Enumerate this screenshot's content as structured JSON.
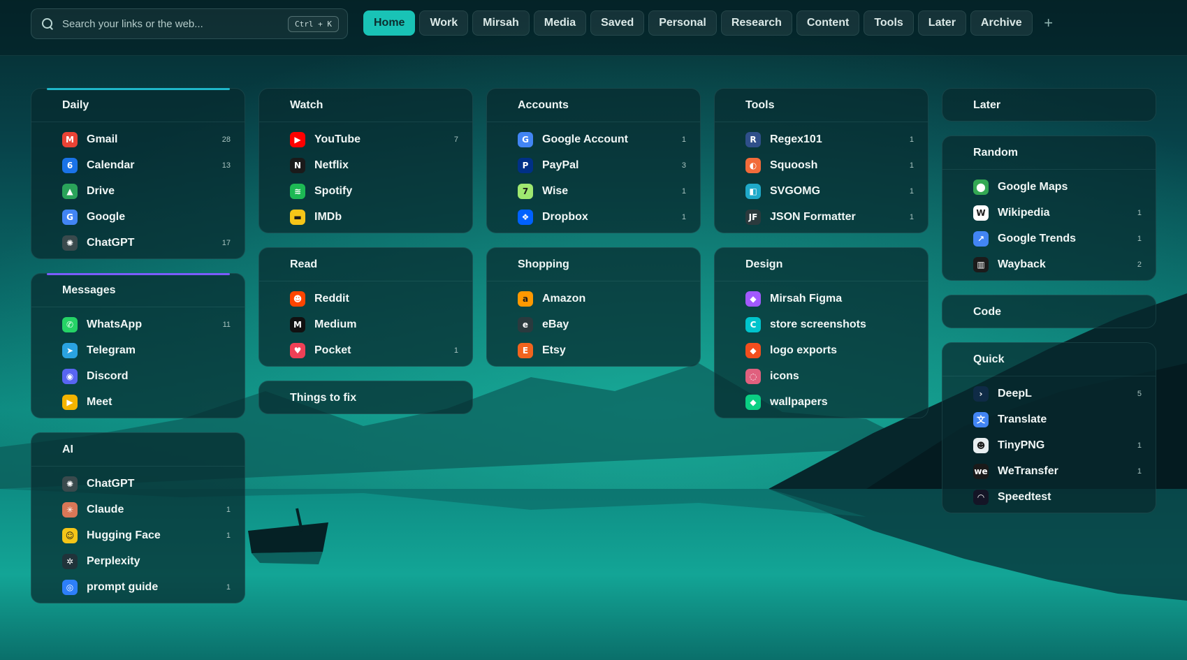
{
  "search": {
    "placeholder": "Search your links or the web...",
    "shortcut": "Ctrl + K"
  },
  "tabs": [
    "Home",
    "Work",
    "Mirsah",
    "Media",
    "Saved",
    "Personal",
    "Research",
    "Content",
    "Tools",
    "Later",
    "Archive"
  ],
  "active_tab": "Home",
  "add_tab_label": "+",
  "columns": [
    [
      {
        "title": "Daily",
        "accent": "#1fb6c9",
        "items": [
          {
            "label": "Gmail",
            "icon": "gmail-icon",
            "glyph": "M",
            "color": "#ea4335",
            "count": "28"
          },
          {
            "label": "Calendar",
            "icon": "calendar-icon",
            "glyph": "6",
            "color": "#1a73e8",
            "count": "13"
          },
          {
            "label": "Drive",
            "icon": "drive-icon",
            "glyph": "▲",
            "color": "#2aa35a",
            "count": ""
          },
          {
            "label": "Google",
            "icon": "google-icon",
            "glyph": "G",
            "color": "#4285f4",
            "count": ""
          },
          {
            "label": "ChatGPT",
            "icon": "chatgpt-icon",
            "glyph": "✺",
            "color": "#3a4a4d",
            "count": "17"
          }
        ]
      },
      {
        "title": "Messages",
        "accent": "#7b5cff",
        "items": [
          {
            "label": "WhatsApp",
            "icon": "whatsapp-icon",
            "glyph": "✆",
            "color": "#25d366",
            "count": "11"
          },
          {
            "label": "Telegram",
            "icon": "telegram-icon",
            "glyph": "➤",
            "color": "#2aa3e0",
            "count": ""
          },
          {
            "label": "Discord",
            "icon": "discord-icon",
            "glyph": "◉",
            "color": "#5865f2",
            "count": ""
          },
          {
            "label": "Meet",
            "icon": "meet-icon",
            "glyph": "▶",
            "color": "#f4b400",
            "count": ""
          }
        ]
      },
      {
        "title": "AI",
        "accent": "",
        "items": [
          {
            "label": "ChatGPT",
            "icon": "chatgpt-icon",
            "glyph": "✺",
            "color": "#3a4a4d",
            "count": ""
          },
          {
            "label": "Claude",
            "icon": "claude-icon",
            "glyph": "✳",
            "color": "#d97757",
            "count": "1"
          },
          {
            "label": "Hugging Face",
            "icon": "hugging-face-icon",
            "glyph": "☺",
            "color": "#f5c518",
            "count": "1"
          },
          {
            "label": "Perplexity",
            "icon": "perplexity-icon",
            "glyph": "✲",
            "color": "#20333a",
            "count": ""
          },
          {
            "label": "prompt guide",
            "icon": "prompt-guide-icon",
            "glyph": "◎",
            "color": "#2d7ff9",
            "count": "1"
          }
        ]
      }
    ],
    [
      {
        "title": "Watch",
        "accent": "",
        "items": [
          {
            "label": "YouTube",
            "icon": "youtube-icon",
            "glyph": "▶",
            "color": "#ff0000",
            "count": "7"
          },
          {
            "label": "Netflix",
            "icon": "netflix-icon",
            "glyph": "N",
            "color": "#1a1a1a",
            "count": ""
          },
          {
            "label": "Spotify",
            "icon": "spotify-icon",
            "glyph": "≋",
            "color": "#1db954",
            "count": ""
          },
          {
            "label": "IMDb",
            "icon": "imdb-icon",
            "glyph": "▬",
            "color": "#f5c518",
            "count": ""
          }
        ]
      },
      {
        "title": "Read",
        "accent": "",
        "items": [
          {
            "label": "Reddit",
            "icon": "reddit-icon",
            "glyph": "☻",
            "color": "#ff4500",
            "count": ""
          },
          {
            "label": "Medium",
            "icon": "medium-icon",
            "glyph": "M",
            "color": "#111111",
            "count": ""
          },
          {
            "label": "Pocket",
            "icon": "pocket-icon",
            "glyph": "♥",
            "color": "#ef4056",
            "count": "1"
          }
        ]
      },
      {
        "title": "Things to fix",
        "accent": "",
        "items": []
      }
    ],
    [
      {
        "title": "Accounts",
        "accent": "",
        "items": [
          {
            "label": "Google Account",
            "icon": "google-icon",
            "glyph": "G",
            "color": "#4285f4",
            "count": "1"
          },
          {
            "label": "PayPal",
            "icon": "paypal-icon",
            "glyph": "P",
            "color": "#003087",
            "count": "3"
          },
          {
            "label": "Wise",
            "icon": "wise-icon",
            "glyph": "7",
            "color": "#9fe870",
            "count": "1"
          },
          {
            "label": "Dropbox",
            "icon": "dropbox-icon",
            "glyph": "❖",
            "color": "#0061ff",
            "count": "1"
          }
        ]
      },
      {
        "title": "Shopping",
        "accent": "",
        "items": [
          {
            "label": "Amazon",
            "icon": "amazon-icon",
            "glyph": "a",
            "color": "#ff9900",
            "count": ""
          },
          {
            "label": "eBay",
            "icon": "ebay-icon",
            "glyph": "e",
            "color": "#2a3a3e",
            "count": ""
          },
          {
            "label": "Etsy",
            "icon": "etsy-icon",
            "glyph": "E",
            "color": "#f1641e",
            "count": ""
          }
        ]
      }
    ],
    [
      {
        "title": "Tools",
        "accent": "",
        "items": [
          {
            "label": "Regex101",
            "icon": "regex101-icon",
            "glyph": "R",
            "color": "#2f4f8a",
            "count": "1"
          },
          {
            "label": "Squoosh",
            "icon": "squoosh-icon",
            "glyph": "◐",
            "color": "#f26b3a",
            "count": "1"
          },
          {
            "label": "SVGOMG",
            "icon": "svgomg-icon",
            "glyph": "◧",
            "color": "#1fa9c9",
            "count": "1"
          },
          {
            "label": "JSON Formatter",
            "icon": "json-formatter-icon",
            "glyph": "JF",
            "color": "#2b3a3d",
            "count": "1"
          }
        ]
      },
      {
        "title": "Design",
        "accent": "",
        "items": [
          {
            "label": "Mirsah Figma",
            "icon": "figma-icon",
            "glyph": "◆",
            "color": "#a259ff",
            "count": ""
          },
          {
            "label": "store screenshots",
            "icon": "canva-icon",
            "glyph": "C",
            "color": "#00c4cc",
            "count": ""
          },
          {
            "label": "logo exports",
            "icon": "figma-icon",
            "glyph": "◆",
            "color": "#f24e1e",
            "count": ""
          },
          {
            "label": "icons",
            "icon": "icons-icon",
            "glyph": "◌",
            "color": "#e0607e",
            "count": ""
          },
          {
            "label": "wallpapers",
            "icon": "figma-icon",
            "glyph": "◆",
            "color": "#0acf83",
            "count": ""
          }
        ]
      }
    ],
    [
      {
        "title": "Later",
        "accent": "",
        "items": []
      },
      {
        "title": "Random",
        "accent": "",
        "items": [
          {
            "label": "Google Maps",
            "icon": "google-maps-icon",
            "glyph": "⬤",
            "color": "#34a853",
            "count": ""
          },
          {
            "label": "Wikipedia",
            "icon": "wikipedia-icon",
            "glyph": "W",
            "color": "#ffffff",
            "count": "1"
          },
          {
            "label": "Google Trends",
            "icon": "google-trends-icon",
            "glyph": "↗",
            "color": "#4285f4",
            "count": "1"
          },
          {
            "label": "Wayback",
            "icon": "wayback-icon",
            "glyph": "▥",
            "color": "#1b1b1b",
            "count": "2"
          }
        ]
      },
      {
        "title": "Code",
        "accent": "",
        "items": []
      },
      {
        "title": "Quick",
        "accent": "",
        "items": [
          {
            "label": "DeepL",
            "icon": "deepl-icon",
            "glyph": "›",
            "color": "#0f2b46",
            "count": "5"
          },
          {
            "label": "Translate",
            "icon": "translate-icon",
            "glyph": "文",
            "color": "#4285f4",
            "count": ""
          },
          {
            "label": "TinyPNG",
            "icon": "tinypng-icon",
            "glyph": "☻",
            "color": "#e8eef0",
            "count": "1"
          },
          {
            "label": "WeTransfer",
            "icon": "wetransfer-icon",
            "glyph": "we",
            "color": "#1a1a1a",
            "count": "1"
          },
          {
            "label": "Speedtest",
            "icon": "speedtest-icon",
            "glyph": "◠",
            "color": "#141526",
            "count": ""
          }
        ]
      }
    ]
  ]
}
